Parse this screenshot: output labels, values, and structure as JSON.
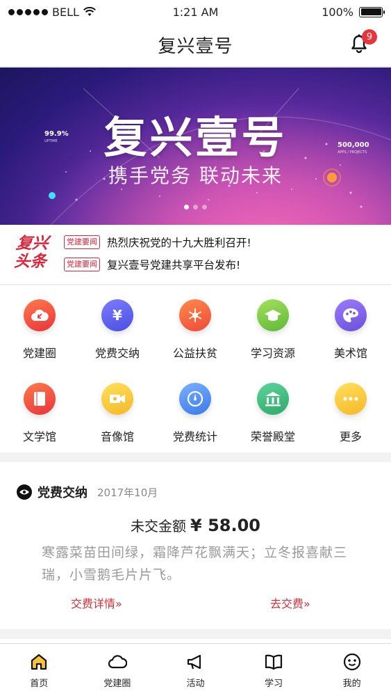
{
  "status_bar": {
    "carrier": "BELL",
    "time": "1:21 AM",
    "battery": "100%"
  },
  "nav": {
    "title": "复兴壹号",
    "notification_count": "9"
  },
  "banner": {
    "headline": "复兴壹号",
    "subtitle": "携手党务 联动未来",
    "stat_left_value": "99.9%",
    "stat_left_label": "UPTIME",
    "stat_right_value": "500,000",
    "stat_right_label": "APPS / PROJECTS",
    "slide_count": 3,
    "active_slide": 1
  },
  "headlines": {
    "logo_line1": "复兴",
    "logo_line2": "头条",
    "items": [
      {
        "tag": "党建要闻",
        "text": "热烈庆祝党的十九大胜利召开!"
      },
      {
        "tag": "党建要闻",
        "text": "复兴壹号党建共享平台发布!"
      }
    ]
  },
  "grid": {
    "items": [
      {
        "label": "党建圈",
        "icon": "party-cloud-icon",
        "color": "#f0553a"
      },
      {
        "label": "党费交纳",
        "icon": "yuan-icon",
        "color": "#5b5ff0"
      },
      {
        "label": "公益扶贫",
        "icon": "snowflake-icon",
        "color": "#f26b3a"
      },
      {
        "label": "学习资源",
        "icon": "graduation-cap-icon",
        "color": "#79c94a"
      },
      {
        "label": "美术馆",
        "icon": "palette-icon",
        "color": "#7b5fe0"
      },
      {
        "label": "文学馆",
        "icon": "book-icon",
        "color": "#f0553a"
      },
      {
        "label": "音像馆",
        "icon": "video-camera-icon",
        "color": "#f8c53a"
      },
      {
        "label": "党费统计",
        "icon": "compass-icon",
        "color": "#4b8df0"
      },
      {
        "label": "荣誉殿堂",
        "icon": "museum-icon",
        "color": "#3db47a"
      },
      {
        "label": "更多",
        "icon": "more-icon",
        "color": "#f8c53a"
      }
    ]
  },
  "fee_card": {
    "title": "党费交纳",
    "date": "2017年10月",
    "amount_label": "未交金额",
    "amount": "¥ 58.00",
    "poem": "寒露菜苗田间绿，霜降芦花飘满天；立冬报喜献三瑞，小雪鹅毛片片飞。",
    "details_link": "交费详情»",
    "pay_link": "去交费»"
  },
  "tabbar": {
    "items": [
      {
        "label": "首页",
        "icon": "home-icon",
        "active": true
      },
      {
        "label": "党建圈",
        "icon": "cloud-icon",
        "active": false
      },
      {
        "label": "活动",
        "icon": "megaphone-icon",
        "active": false
      },
      {
        "label": "学习",
        "icon": "book-open-icon",
        "active": false
      },
      {
        "label": "我的",
        "icon": "smiley-icon",
        "active": false
      }
    ]
  },
  "colors": {
    "accent_red": "#d9263a",
    "tab_active_fill": "#f8c53a"
  }
}
